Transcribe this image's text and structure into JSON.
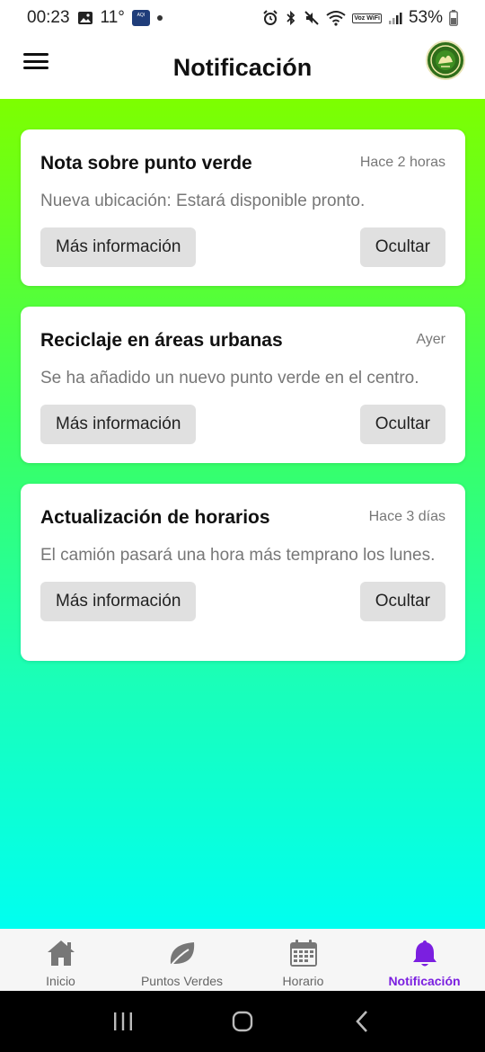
{
  "status_bar": {
    "time": "00:23",
    "temperature": "11°",
    "aqi_label": "AQI",
    "voz_label": "Voz WiFi",
    "battery": "53%"
  },
  "header": {
    "title": "Notificación"
  },
  "colors": {
    "active_nav": "#7b1fe0",
    "gradient_top": "#7dff00",
    "gradient_bottom": "#00fff0"
  },
  "notifications": [
    {
      "title": "Nota sobre punto verde",
      "time": "Hace 2 horas",
      "message": "Nueva ubicación: Estará disponible pronto.",
      "more_label": "Más información",
      "hide_label": "Ocultar"
    },
    {
      "title": "Reciclaje en áreas urbanas",
      "time": "Ayer",
      "message": "Se ha añadido un nuevo punto verde en el centro.",
      "more_label": "Más información",
      "hide_label": "Ocultar"
    },
    {
      "title": "Actualización de horarios",
      "time": "Hace 3 días",
      "message": "El camión pasará una hora más temprano los lunes.",
      "more_label": "Más información",
      "hide_label": "Ocultar"
    }
  ],
  "bottom_nav": [
    {
      "label": "Inicio",
      "icon": "home-icon",
      "active": false
    },
    {
      "label": "Puntos Verdes",
      "icon": "leaf-icon",
      "active": false
    },
    {
      "label": "Horario",
      "icon": "calendar-icon",
      "active": false
    },
    {
      "label": "Notificación",
      "icon": "bell-icon",
      "active": true
    }
  ]
}
